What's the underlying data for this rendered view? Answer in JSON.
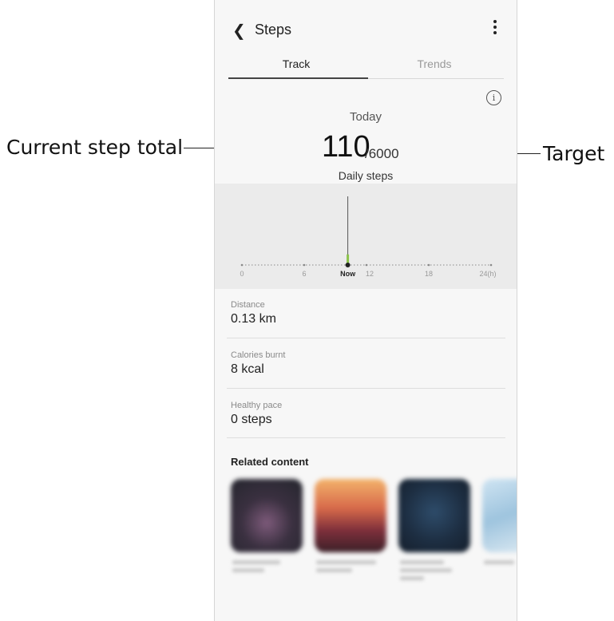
{
  "callouts": {
    "current_step_total": "Current step total",
    "target": "Target"
  },
  "header": {
    "title": "Steps",
    "back_icon": "chevron-left-icon",
    "more_icon": "more-vertical-icon"
  },
  "tabs": [
    {
      "label": "Track",
      "active": true
    },
    {
      "label": "Trends",
      "active": false
    }
  ],
  "summary": {
    "info_icon": "info-icon",
    "info_glyph": "i",
    "day": "Today",
    "steps": "110",
    "target": "/6000",
    "caption": "Daily steps"
  },
  "chart_data": {
    "type": "bar",
    "x_tick_labels": [
      "0",
      "6",
      "Now",
      "12",
      "18",
      "24(h)"
    ],
    "x_ticks_hours": [
      0,
      6,
      12,
      18,
      24
    ],
    "xlim": [
      0,
      24
    ],
    "now_hour": 10.2,
    "bars": [
      {
        "hour": 10.2,
        "steps": 110
      }
    ],
    "bar_color": "#8bc34a"
  },
  "stats": [
    {
      "label": "Distance",
      "value": "0.13 km"
    },
    {
      "label": "Calories burnt",
      "value": "8 kcal"
    },
    {
      "label": "Healthy pace",
      "value": "0 steps"
    }
  ],
  "related": {
    "title": "Related content"
  }
}
